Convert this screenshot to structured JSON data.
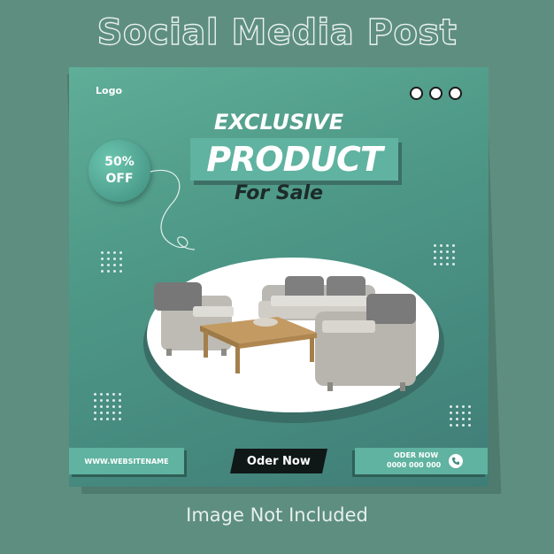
{
  "page": {
    "title": "Social Media Post",
    "caption": "Image Not Included"
  },
  "card": {
    "logo": "Logo",
    "headline": {
      "line1": "EXCLUSIVE",
      "line2": "PRODUCT",
      "line3": "For Sale"
    },
    "discount": {
      "percent": "50%",
      "label": "OFF"
    },
    "website": "WWW.WEBSITENAME",
    "cta_label": "Oder Now",
    "order": {
      "label": "ODER NOW",
      "phone": "0000 000 000"
    }
  },
  "colors": {
    "background": "#5e8e80",
    "card_gradient_start": "#5fae98",
    "card_gradient_end": "#3f7d77",
    "accent": "#5fb3a0",
    "cta_background": "#0f1717"
  },
  "icons": {
    "menu_dots": "three-dots-icon",
    "phone": "phone-icon"
  }
}
